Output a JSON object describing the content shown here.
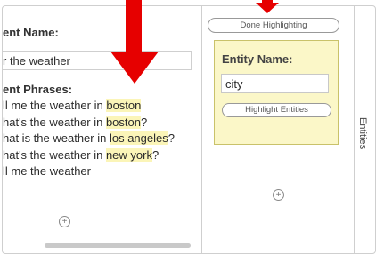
{
  "left_panel": {
    "intent_name_label": "ent Name:",
    "intent_name_value": "r the weather",
    "phrases_label": "ent Phrases:",
    "phrases": [
      {
        "pre": "ll me the weather in ",
        "entity": "boston",
        "post": ""
      },
      {
        "pre": "hat's the weather in ",
        "entity": "boston",
        "post": "?"
      },
      {
        "pre": "hat is the weather in ",
        "entity": "los angeles",
        "post": "?"
      },
      {
        "pre": "hat's the weather in ",
        "entity": "new york",
        "post": "?"
      },
      {
        "pre": "ll me the weather",
        "entity": "",
        "post": ""
      }
    ],
    "add_icon": "plus-circle-icon"
  },
  "middle_panel": {
    "done_button_label": "Done Highlighting",
    "entity_name_label": "Entity Name:",
    "entity_name_value": "city",
    "highlight_button_label": "Highlight Entities",
    "add_icon": "plus-circle-icon"
  },
  "right_panel": {
    "tab_label": "Entities"
  },
  "colors": {
    "highlight": "#fbf5b8",
    "entity_box": "#fbf7c8",
    "arrow": "#e60000"
  }
}
